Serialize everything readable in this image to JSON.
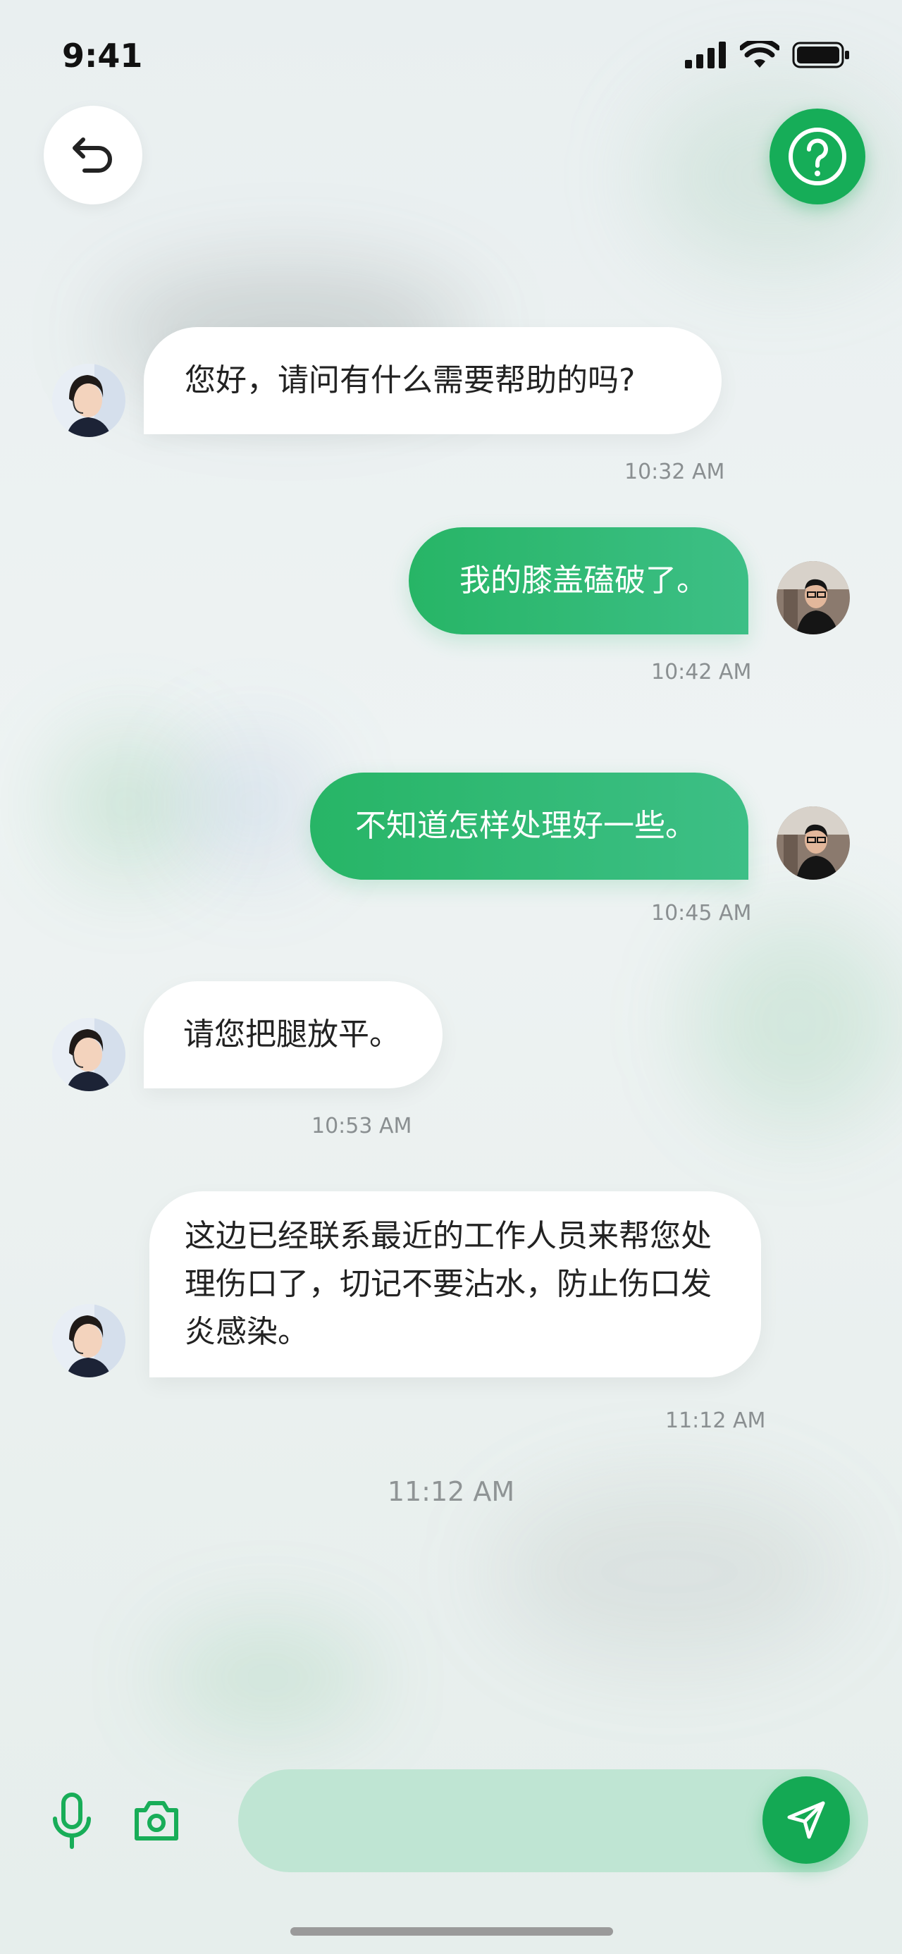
{
  "status_bar": {
    "time": "9:41"
  },
  "header": {
    "back_icon": "undo-arrow-icon",
    "help_icon": "question-circle-icon"
  },
  "colors": {
    "accent": "#16ad58",
    "incoming_bubble": "#ffffff",
    "outgoing_bubble": "#2fb873",
    "input_bg": "#bfe5d3"
  },
  "messages": [
    {
      "from": "agent",
      "text": "您好，请问有什么需要帮助的吗?",
      "time": "10:32 AM"
    },
    {
      "from": "user",
      "text": "我的膝盖磕破了。",
      "time": "10:42 AM"
    },
    {
      "from": "user",
      "text": "不知道怎样处理好一些。",
      "time": "10:45 AM"
    },
    {
      "from": "agent",
      "text": "请您把腿放平。",
      "time": "10:53 AM"
    },
    {
      "from": "agent",
      "text": "这边已经联系最近的工作人员来帮您处理伤口了，切记不要沾水，防止伤口发炎感染。",
      "time": "11:12 AM"
    }
  ],
  "footer_time": "11:12 AM",
  "composer": {
    "mic_icon": "microphone-icon",
    "camera_icon": "camera-icon",
    "send_icon": "send-icon"
  }
}
